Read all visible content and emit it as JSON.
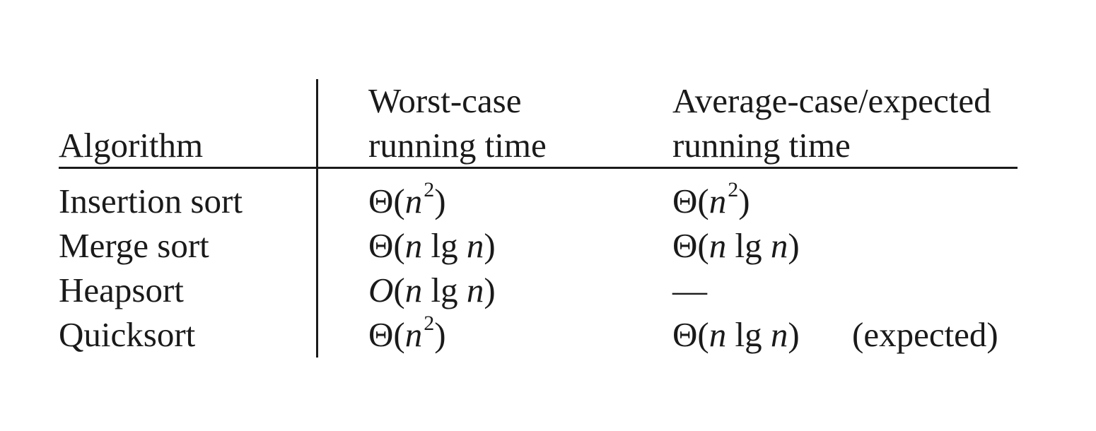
{
  "header": {
    "algorithm": "Algorithm",
    "worst_line1": "Worst-case",
    "worst_line2": "running time",
    "avg_line1": "Average-case/expected",
    "avg_line2": "running time"
  },
  "rows": [
    {
      "algorithm": "Insertion sort",
      "worst": {
        "fn": "Θ",
        "arg": "n",
        "exp": "2"
      },
      "avg": {
        "fn": "Θ",
        "arg": "n",
        "exp": "2"
      }
    },
    {
      "algorithm": "Merge sort",
      "worst": {
        "fn": "Θ",
        "a": "n",
        "lg": "lg",
        "b": "n"
      },
      "avg": {
        "fn": "Θ",
        "a": "n",
        "lg": "lg",
        "b": "n"
      }
    },
    {
      "algorithm": "Heapsort",
      "worst": {
        "fn": "O",
        "a": "n",
        "lg": "lg",
        "b": "n"
      },
      "avg": {
        "text": "—"
      }
    },
    {
      "algorithm": "Quicksort",
      "worst": {
        "fn": "Θ",
        "arg": "n",
        "exp": "2"
      },
      "avg": {
        "fn": "Θ",
        "a": "n",
        "lg": "lg",
        "b": "n",
        "note": "(expected)"
      }
    }
  ]
}
